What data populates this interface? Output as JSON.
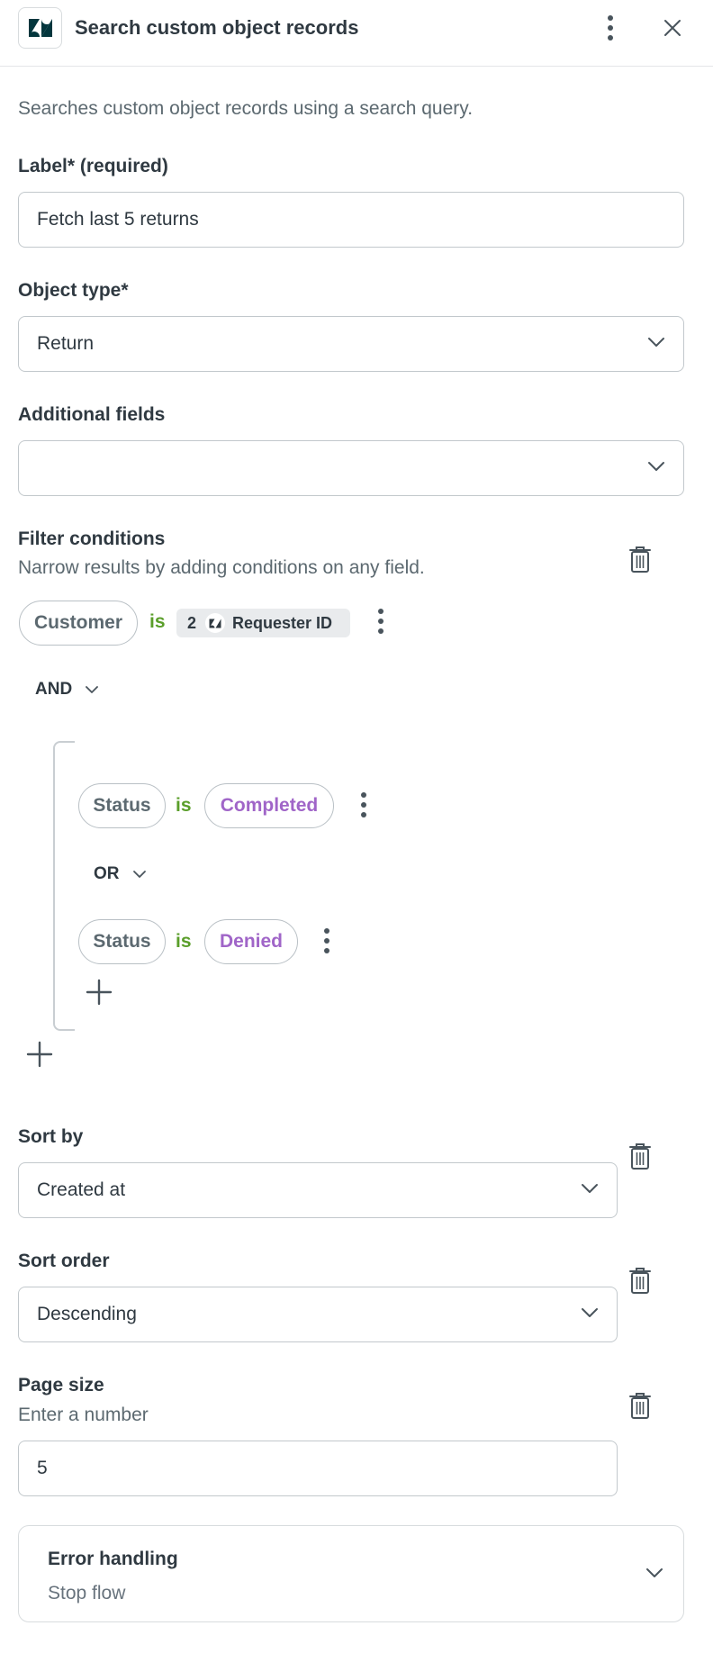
{
  "header": {
    "title": "Search custom object records",
    "logo_icon": "zendesk-logo",
    "menu_icon": "kebab-icon",
    "close_icon": "close-icon"
  },
  "description": "Searches custom object records using a search query.",
  "label_field": {
    "label": "Label* (required)",
    "value": "Fetch last 5 returns"
  },
  "object_type": {
    "label": "Object type*",
    "value": "Return"
  },
  "additional_fields": {
    "label": "Additional fields",
    "value": ""
  },
  "filter": {
    "label": "Filter conditions",
    "hint": "Narrow results by adding conditions on any field.",
    "condition1": {
      "field": "Customer",
      "operator": "is",
      "chip_step": "2",
      "chip_label": "Requester ID"
    },
    "join": "AND",
    "group": {
      "condition1": {
        "field": "Status",
        "operator": "is",
        "value": "Completed"
      },
      "join": "OR",
      "condition2": {
        "field": "Status",
        "operator": "is",
        "value": "Denied"
      }
    }
  },
  "sort_by": {
    "label": "Sort by",
    "value": "Created at"
  },
  "sort_order": {
    "label": "Sort order",
    "value": "Descending"
  },
  "page_size": {
    "label": "Page size",
    "hint": "Enter a number",
    "value": "5"
  },
  "error_handling": {
    "label": "Error handling",
    "value": "Stop flow"
  },
  "colors": {
    "operator": "#5a9e2a",
    "value_pill": "#a065c8",
    "border": "#c2c8cc"
  }
}
